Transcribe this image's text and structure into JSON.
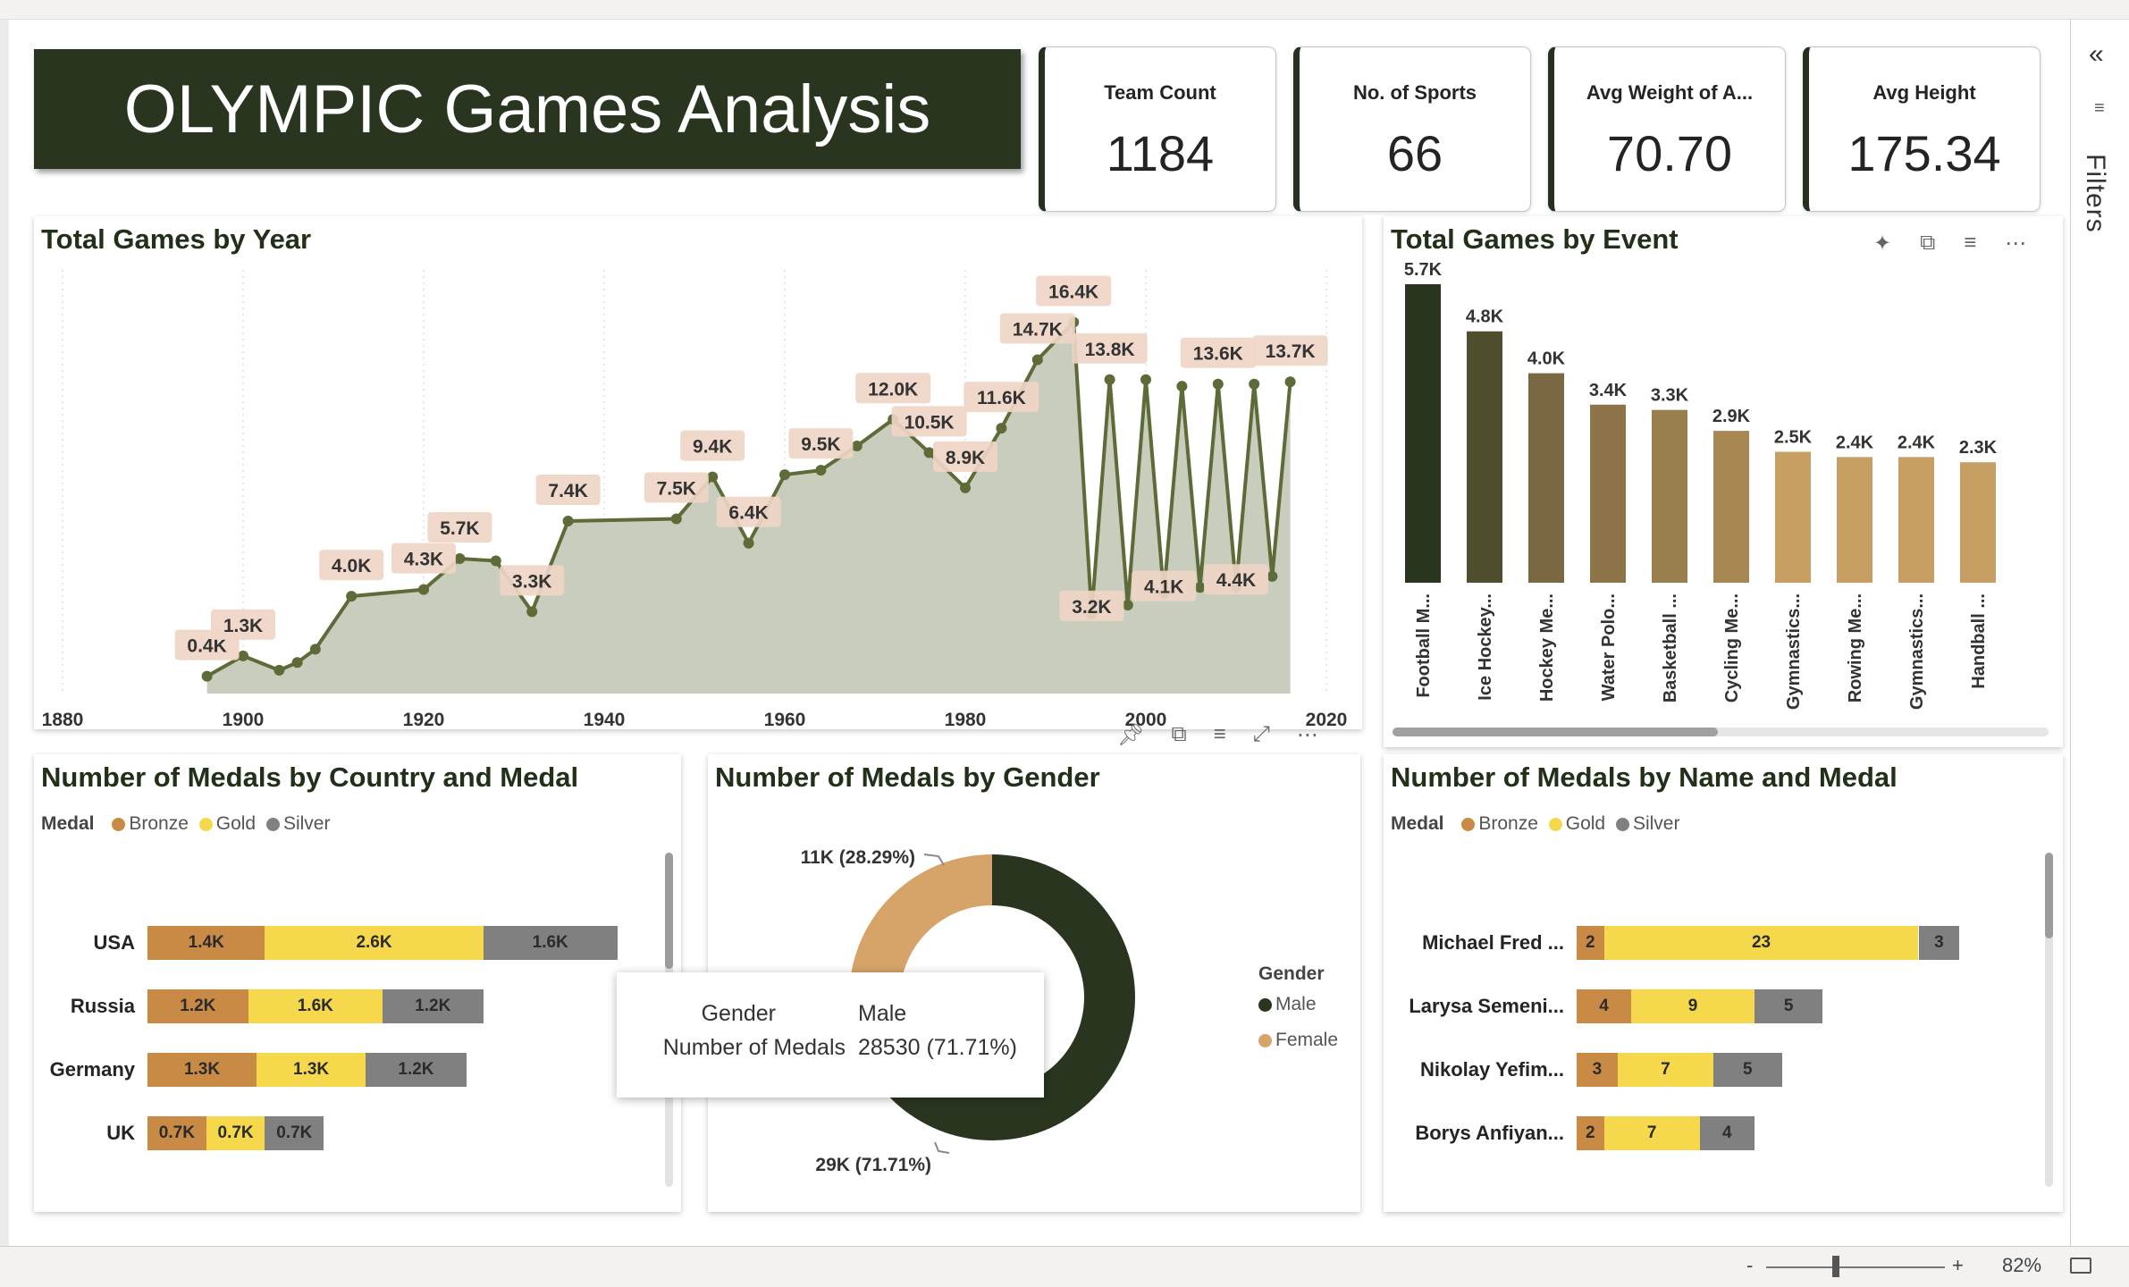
{
  "header": {
    "title": "OLYMPIC Games Analysis"
  },
  "kpis": [
    {
      "label": "Team Count",
      "value": "1184"
    },
    {
      "label": "No. of Sports",
      "value": "66"
    },
    {
      "label": "Avg Weight of A...",
      "value": "70.70"
    },
    {
      "label": "Avg Height",
      "value": "175.34"
    }
  ],
  "filters": {
    "label": "Filters",
    "collapse_icon": "«"
  },
  "status": {
    "zoom": "82%",
    "minus": "-",
    "plus": "+"
  },
  "colors": {
    "dark_green": "#2a3520",
    "olive_line": "#5c6b37",
    "area_fill": "#c9cdbd",
    "label_bg": "#efd6c6",
    "bronze": "#c98a45",
    "gold": "#f5d84b",
    "silver": "#808080",
    "female": "#d6a468"
  },
  "charts": {
    "year": {
      "title": "Total Games by Year",
      "chart_data": {
        "type": "area",
        "x": [
          1896,
          1900,
          1904,
          1906,
          1908,
          1912,
          1920,
          1924,
          1928,
          1932,
          1936,
          1948,
          1952,
          1956,
          1960,
          1964,
          1968,
          1972,
          1976,
          1980,
          1984,
          1988,
          1992,
          1994,
          1996,
          1998,
          2000,
          2002,
          2004,
          2006,
          2008,
          2010,
          2012,
          2014,
          2016
        ],
        "y": [
          380,
          1300,
          650,
          1000,
          1600,
          4000,
          4300,
          5700,
          5600,
          3300,
          7400,
          7500,
          9400,
          6400,
          9500,
          9700,
          10800,
          12000,
          10500,
          8900,
          11600,
          14700,
          16400,
          3200,
          13800,
          3600,
          13800,
          4100,
          13500,
          4400,
          13600,
          4400,
          13600,
          4900,
          13700
        ],
        "xlim": [
          1880,
          2020
        ],
        "xticks": [
          "1880",
          "1900",
          "1920",
          "1940",
          "1960",
          "1980",
          "2000",
          "2020"
        ],
        "labels": [
          {
            "x": 1896,
            "y": 380,
            "text": "0.4K"
          },
          {
            "x": 1900,
            "y": 1300,
            "text": "1.3K"
          },
          {
            "x": 1912,
            "y": 4000,
            "text": "4.0K"
          },
          {
            "x": 1920,
            "y": 4300,
            "text": "4.3K"
          },
          {
            "x": 1924,
            "y": 5700,
            "text": "5.7K"
          },
          {
            "x": 1932,
            "y": 3300,
            "text": "3.3K"
          },
          {
            "x": 1936,
            "y": 7400,
            "text": "7.4K"
          },
          {
            "x": 1948,
            "y": 7500,
            "text": "7.5K"
          },
          {
            "x": 1952,
            "y": 9400,
            "text": "9.4K"
          },
          {
            "x": 1956,
            "y": 6400,
            "text": "6.4K"
          },
          {
            "x": 1964,
            "y": 9500,
            "text": "9.5K"
          },
          {
            "x": 1972,
            "y": 12000,
            "text": "12.0K"
          },
          {
            "x": 1976,
            "y": 10500,
            "text": "10.5K"
          },
          {
            "x": 1980,
            "y": 8900,
            "text": "8.9K"
          },
          {
            "x": 1984,
            "y": 11600,
            "text": "11.6K"
          },
          {
            "x": 1988,
            "y": 14700,
            "text": "14.7K"
          },
          {
            "x": 1992,
            "y": 16400,
            "text": "16.4K"
          },
          {
            "x": 1994,
            "y": 3200,
            "text": "3.2K"
          },
          {
            "x": 1996,
            "y": 13800,
            "text": "13.8K"
          },
          {
            "x": 2002,
            "y": 4100,
            "text": "4.1K"
          },
          {
            "x": 2008,
            "y": 13600,
            "text": "13.6K"
          },
          {
            "x": 2010,
            "y": 4400,
            "text": "4.4K"
          },
          {
            "x": 2016,
            "y": 13700,
            "text": "13.7K"
          }
        ]
      }
    },
    "event": {
      "title": "Total Games by Event",
      "chart_data": {
        "type": "bar",
        "categories": [
          "Football M...",
          "Ice Hockey...",
          "Hockey Me...",
          "Water Polo...",
          "Basketball ...",
          "Cycling Me...",
          "Gymnastics...",
          "Rowing Me...",
          "Gymnastics...",
          "Handball ..."
        ],
        "values": [
          5700,
          4800,
          4000,
          3400,
          3300,
          2900,
          2500,
          2400,
          2400,
          2300
        ],
        "value_labels": [
          "5.7K",
          "4.8K",
          "4.0K",
          "3.4K",
          "3.3K",
          "2.9K",
          "2.5K",
          "2.4K",
          "2.4K",
          "2.3K"
        ],
        "colors": [
          "#2a3520",
          "#4f4f2f",
          "#7a6843",
          "#8d7549",
          "#9a7f4f",
          "#a78855",
          "#c89f62",
          "#c89f62",
          "#c89f62",
          "#c89f62"
        ],
        "ylim": [
          0,
          5700
        ]
      }
    },
    "country": {
      "title": "Number of Medals by Country and Medal",
      "legend_title": "Medal",
      "legend": [
        "Bronze",
        "Gold",
        "Silver"
      ],
      "chart_data": {
        "type": "bar",
        "orientation": "horizontal-stacked",
        "categories": [
          "USA",
          "Russia",
          "Germany",
          "UK"
        ],
        "series": [
          {
            "name": "Bronze",
            "values": [
              1400,
              1200,
              1300,
              700
            ],
            "labels": [
              "1.4K",
              "1.2K",
              "1.3K",
              "0.7K"
            ]
          },
          {
            "name": "Gold",
            "values": [
              2600,
              1600,
              1300,
              700
            ],
            "labels": [
              "2.6K",
              "1.6K",
              "1.3K",
              "0.7K"
            ]
          },
          {
            "name": "Silver",
            "values": [
              1600,
              1200,
              1200,
              700
            ],
            "labels": [
              "1.6K",
              "1.2K",
              "1.2K",
              "0.7K"
            ]
          }
        ]
      }
    },
    "gender": {
      "title": "Number of Medals by Gender",
      "legend_title": "Gender",
      "legend": [
        "Male",
        "Female"
      ],
      "chart_data": {
        "type": "pie",
        "categories": [
          "Male",
          "Female"
        ],
        "values": [
          28530,
          11250
        ],
        "labels": [
          "29K (71.71%)",
          "11K (28.29%)"
        ]
      },
      "tooltip": {
        "k1": "Gender",
        "v1": "Male",
        "k2": "Number of Medals",
        "v2": "28530 (71.71%)"
      }
    },
    "name": {
      "title": "Number of Medals by Name and Medal",
      "legend_title": "Medal",
      "legend": [
        "Bronze",
        "Gold",
        "Silver"
      ],
      "chart_data": {
        "type": "bar",
        "orientation": "horizontal-stacked",
        "categories": [
          "Michael Fred ...",
          "Larysa Semeni...",
          "Nikolay Yefim...",
          "Borys Anfiyan..."
        ],
        "series": [
          {
            "name": "Bronze",
            "values": [
              2,
              4,
              3,
              2
            ],
            "labels": [
              "2",
              "4",
              "3",
              "2"
            ]
          },
          {
            "name": "Gold",
            "values": [
              23,
              9,
              7,
              7
            ],
            "labels": [
              "23",
              "9",
              "7",
              "7"
            ]
          },
          {
            "name": "Silver",
            "values": [
              3,
              5,
              5,
              4
            ],
            "labels": [
              "3",
              "5",
              "5",
              "4"
            ]
          }
        ]
      }
    }
  }
}
